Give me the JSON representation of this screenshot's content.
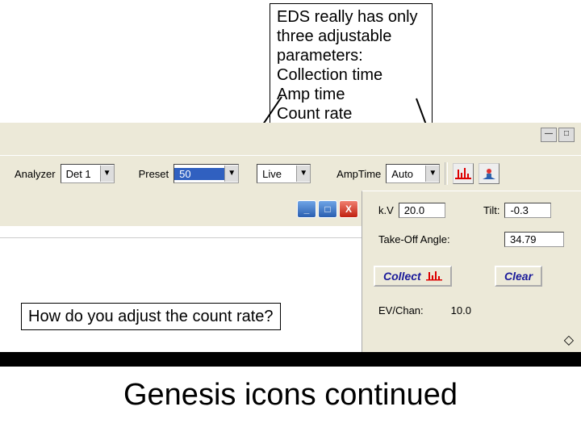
{
  "callout_top": {
    "line1": "EDS really has only",
    "line2": "three adjustable",
    "line3": "parameters:",
    "line4": "Collection time",
    "line5": "Amp time",
    "line6": "Count rate"
  },
  "callout_q": "How do you adjust the count rate?",
  "big_title": "Genesis icons continued",
  "toolbar": {
    "analyzer_label": "Analyzer",
    "analyzer_value": "Det 1",
    "preset_label": "Preset",
    "preset_value": "50",
    "mode_value": "Live",
    "amptime_label": "AmpTime",
    "amptime_value": "Auto"
  },
  "right_panel": {
    "kv_label": "k.V",
    "kv_value": "20.0",
    "tilt_label": "Tilt:",
    "tilt_value": "-0.3",
    "takeoff_label": "Take-Off Angle:",
    "takeoff_value": "34.79",
    "collect_label": "Collect",
    "clear_label": "Clear",
    "evchan_label": "EV/Chan:",
    "evchan_value": "10.0"
  },
  "titlebar": {
    "min": "_",
    "max": "□",
    "close": "X"
  },
  "topwin": {
    "min": "—",
    "max": "□"
  }
}
